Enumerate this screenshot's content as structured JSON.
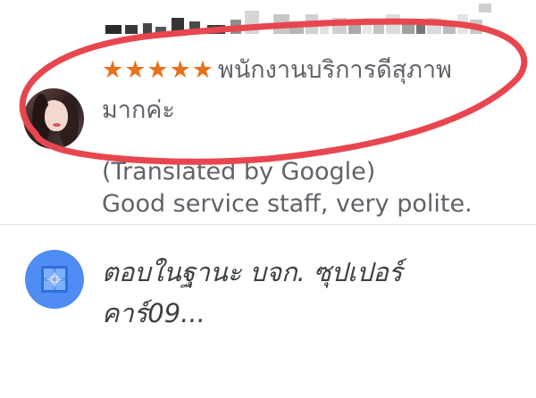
{
  "review": {
    "rating_stars": "★★★★★",
    "rating_value": 5,
    "text_line1": "พนักงานบริการดีสุภาพ",
    "text_line2": "มากค่ะ",
    "translated_label": "(Translated by Google)",
    "translated_text": "Good service staff, very polite."
  },
  "reply": {
    "text_line1": "ตอบในฐานะ บจก. ซุปเปอร์",
    "text_line2": "คาร์09..."
  },
  "colors": {
    "star": "#e8711c",
    "highlight": "#e8464f",
    "reply_icon": "#4f8cf3",
    "text": "#5f6368"
  }
}
